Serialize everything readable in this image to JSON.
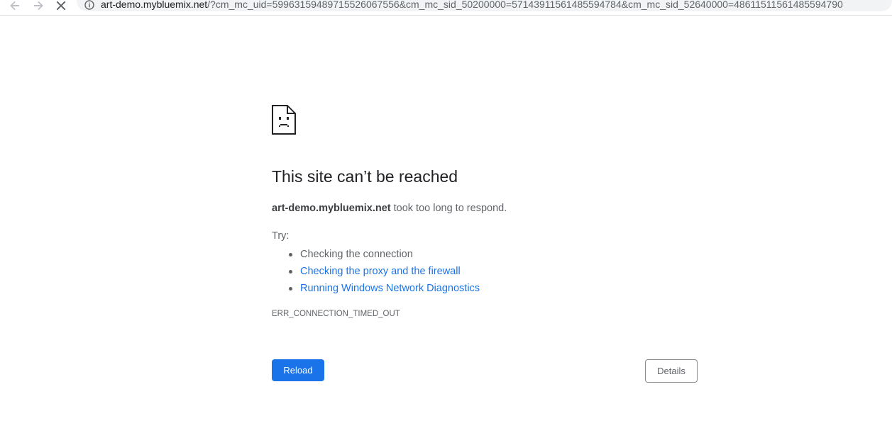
{
  "browser": {
    "back_icon": "arrow-left-icon",
    "forward_icon": "arrow-right-icon",
    "stop_icon": "close-icon",
    "info_icon": "info-icon",
    "url_host": "art-demo.mybluemix.net",
    "url_rest": "/?cm_mc_uid=59963159489715526067556&cm_mc_sid_50200000=57143911561485594784&cm_mc_sid_52640000=48611511561485594790"
  },
  "error_page": {
    "icon": "sad-page-icon",
    "headline": "This site can’t be reached",
    "host": "art-demo.mybluemix.net",
    "message_suffix": " took too long to respond.",
    "try_label": "Try:",
    "suggestions": [
      "Checking the connection",
      "Checking the proxy and the firewall",
      "Running Windows Network Diagnostics"
    ],
    "error_code": "ERR_CONNECTION_TIMED_OUT",
    "reload_label": "Reload",
    "details_label": "Details"
  },
  "colors": {
    "accent": "#1a73e8",
    "text_primary": "#202124",
    "text_secondary": "#5f6368",
    "omnibox_bg": "#f1f3f4"
  }
}
